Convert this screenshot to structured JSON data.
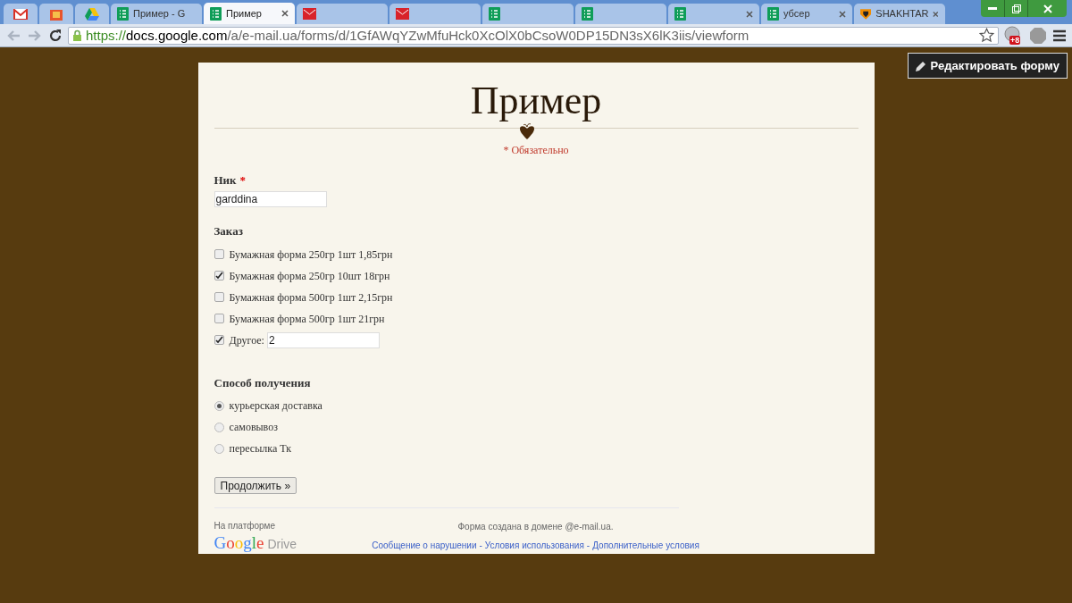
{
  "tabs": [
    {
      "kind": "pinned",
      "selected": false
    },
    {
      "kind": "pinned",
      "selected": false
    },
    {
      "kind": "pinned",
      "selected": false
    },
    {
      "kind": "normal",
      "title": "Пример - G",
      "closable": false,
      "selected": false
    },
    {
      "kind": "normal",
      "title": "Пример",
      "closable": true,
      "selected": true
    },
    {
      "kind": "normal",
      "closable": false,
      "selected": false
    },
    {
      "kind": "normal",
      "closable": false,
      "selected": false
    },
    {
      "kind": "normal",
      "closable": false,
      "selected": false
    },
    {
      "kind": "normal",
      "closable": false,
      "selected": false
    },
    {
      "kind": "normal",
      "closable": true,
      "selected": false
    },
    {
      "kind": "normal",
      "title": "убсер",
      "closable": true,
      "selected": false
    },
    {
      "kind": "normal",
      "title": "SHAKHTAR",
      "closable": true,
      "selected": false
    }
  ],
  "address_bar": {
    "scheme": "https://",
    "host": "docs.google.com",
    "path": "/a/e-mail.ua/forms/d/1GfAWqYZwMfuHck0XcOlX0bCsoW0DP15DN3sX6lK3iis/viewform"
  },
  "extension_badge": "+8",
  "edit_button": "Редактировать форму",
  "form": {
    "title": "Пример",
    "required_note": "* Обязательно",
    "nick": {
      "label": "Ник",
      "required_mark": "*",
      "value": "garddina"
    },
    "order": {
      "label": "Заказ",
      "options": [
        {
          "kind": "option",
          "label": "Бумажная форма 250гр 1шт 1,85грн",
          "checked": false
        },
        {
          "kind": "option",
          "label": "Бумажная форма 250гр 10шт 18грн",
          "checked": true
        },
        {
          "kind": "option",
          "label": "Бумажная форма 500гр 1шт 2,15грн",
          "checked": false
        },
        {
          "kind": "option",
          "label": "Бумажная форма 500гр 1шт 21грн",
          "checked": false
        },
        {
          "kind": "other",
          "label": "Другое:",
          "value": "2",
          "checked": true
        }
      ]
    },
    "delivery": {
      "label": "Способ получения",
      "options": [
        {
          "label": "курьерская доставка",
          "selected": true
        },
        {
          "label": "самовывоз",
          "selected": false
        },
        {
          "label": "пересылка Тк",
          "selected": false
        }
      ]
    },
    "submit": "Продолжить »"
  },
  "footer": {
    "platform": "На платформе",
    "logo_google": "Google",
    "logo_drive": "Drive",
    "domain_note": "Форма создана в домене @e-mail.ua.",
    "links": [
      "Сообщение о нарушении",
      "Условия использования",
      "Дополнительные условия"
    ],
    "separator": "-"
  }
}
